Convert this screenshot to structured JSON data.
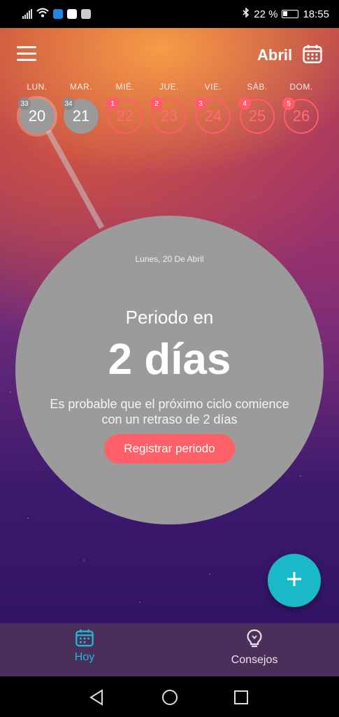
{
  "status_bar": {
    "battery_text": "22 %",
    "time": "18:55"
  },
  "header": {
    "month": "Abril",
    "menu_icon": "hamburger-menu-icon",
    "calendar_icon": "calendar-icon"
  },
  "week": {
    "days": [
      {
        "weekday": "LUN.",
        "day": "20",
        "badge": "33",
        "state": "past"
      },
      {
        "weekday": "MAR.",
        "day": "21",
        "badge": "34",
        "state": "past"
      },
      {
        "weekday": "MIÉ.",
        "day": "22",
        "badge": "1",
        "state": "period"
      },
      {
        "weekday": "JUE.",
        "day": "23",
        "badge": "2",
        "state": "period"
      },
      {
        "weekday": "VIE.",
        "day": "24",
        "badge": "3",
        "state": "period"
      },
      {
        "weekday": "SÁB.",
        "day": "25",
        "badge": "4",
        "state": "period"
      },
      {
        "weekday": "DOM.",
        "day": "26",
        "badge": "5",
        "state": "period"
      }
    ]
  },
  "main": {
    "date_caption": "Lunes, 20 De Abril",
    "title": "Periodo en",
    "days_text": "2 días",
    "note_line1": "Es probable que el próximo ciclo comience",
    "note_line2": "con un retraso de 2 días",
    "register_button": "Registrar periodo"
  },
  "fab": {
    "icon": "plus-icon"
  },
  "bottom_nav": {
    "items": [
      {
        "label": "Hoy",
        "icon": "calendar-icon",
        "active": true
      },
      {
        "label": "Consejos",
        "icon": "lightbulb-icon",
        "active": false
      }
    ]
  },
  "colors": {
    "accent_red": "#ff5f67",
    "fab_teal": "#1ab9c8",
    "active_tab": "#22b7d3",
    "circle_gray": "#9b9b9b",
    "nav_bg": "#4a2f5a"
  }
}
